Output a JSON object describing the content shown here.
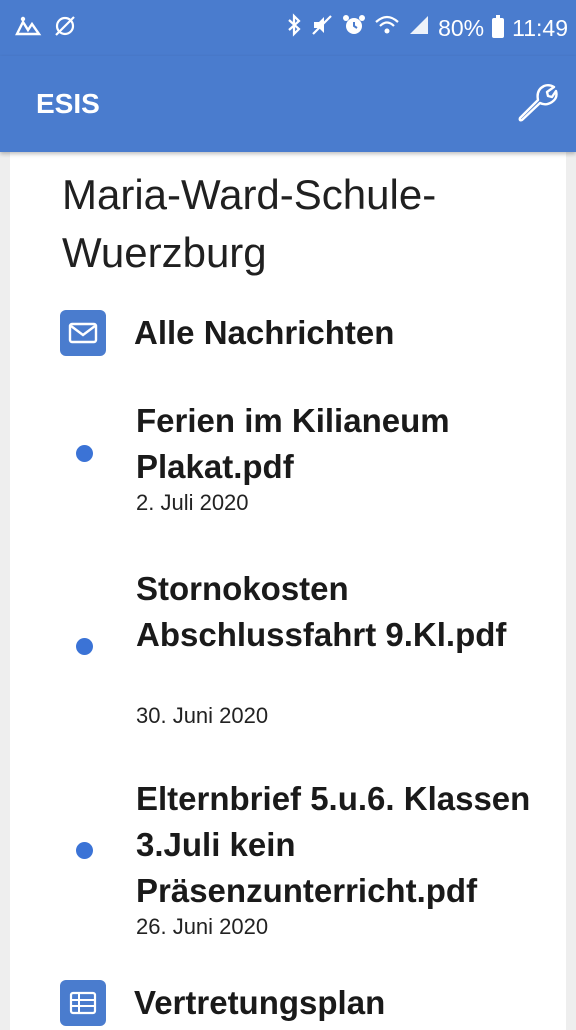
{
  "status_bar": {
    "battery": "80%",
    "time": "11:49"
  },
  "app_bar": {
    "title": "ESIS",
    "settings_icon": "wrench-icon"
  },
  "content": {
    "school_name": "Maria-Ward-Schule-Wuerzburg",
    "sections": {
      "messages": {
        "icon": "mail-icon",
        "label": "Alle Nachrichten"
      },
      "substitution": {
        "icon": "table-icon",
        "label": "Vertretungsplan"
      }
    },
    "messages": [
      {
        "title": "Ferien im Kilianeum Plakat.pdf",
        "date": "2. Juli 2020"
      },
      {
        "title": "Stornokosten Abschlussfahrt 9.Kl.pdf",
        "date": "30. Juni 2020"
      },
      {
        "title": "Elternbrief 5.u.6. Klassen 3.Juli kein Präsenzunterricht.pdf",
        "date": "26. Juni 2020"
      }
    ]
  },
  "colors": {
    "primary": "#4a7cce",
    "dot": "#3b73d6",
    "background": "#eeeeee"
  }
}
